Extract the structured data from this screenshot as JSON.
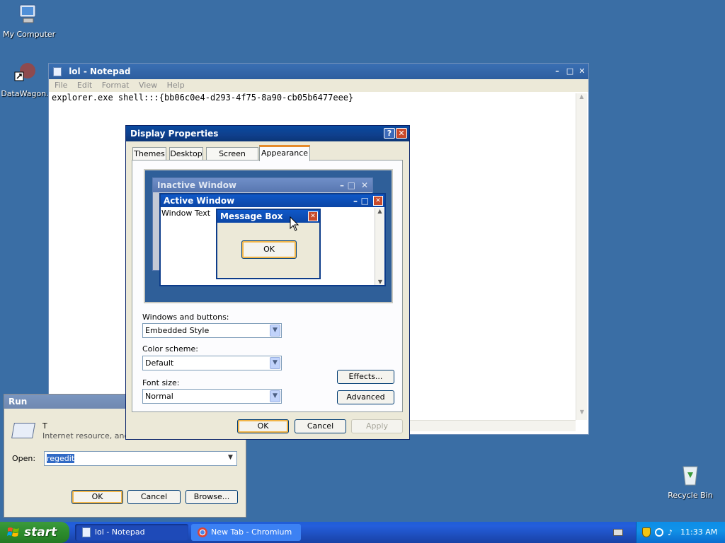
{
  "desktop": {
    "icons": [
      {
        "label": "My Computer"
      },
      {
        "label": "DataWagon."
      },
      {
        "label": "Recycle Bin"
      }
    ]
  },
  "notepad": {
    "title": "lol - Notepad",
    "menu": [
      "File",
      "Edit",
      "Format",
      "View",
      "Help"
    ],
    "content": "explorer.exe shell:::{bb06c0e4-d293-4f75-8a90-cb05b6477eee}"
  },
  "display_properties": {
    "title": "Display Properties",
    "help_btn": "?",
    "tabs": [
      "Themes",
      "Desktop",
      "Screen Saver",
      "Appearance"
    ],
    "active_tab": "Appearance",
    "preview": {
      "inactive_title": "Inactive Window",
      "active_title": "Active Window",
      "window_text": "Window Text",
      "msgbox_title": "Message Box",
      "msgbox_ok": "OK"
    },
    "windows_buttons_label": "Windows and buttons:",
    "windows_buttons_value": "Embedded Style",
    "color_scheme_label": "Color scheme:",
    "color_scheme_value": "Default",
    "font_size_label": "Font size:",
    "font_size_value": "Normal",
    "effects_btn": "Effects...",
    "advanced_btn": "Advanced",
    "ok_btn": "OK",
    "cancel_btn": "Cancel",
    "apply_btn": "Apply"
  },
  "run_dialog": {
    "title": "Run",
    "desc_line1": "T",
    "desc_line2": "Internet resource, and",
    "open_label": "Open:",
    "open_value": "regedit",
    "ok_btn": "OK",
    "cancel_btn": "Cancel",
    "browse_btn": "Browse..."
  },
  "taskbar": {
    "start_label": "start",
    "tasks": [
      {
        "label": "lol - Notepad"
      },
      {
        "label": "New Tab - Chromium"
      }
    ],
    "clock": "11:33 AM"
  },
  "colors": {
    "desktop": "#3a6ea5",
    "title_active": "#0a4aa0",
    "taskbar": "#245edb",
    "start": "#2c8c2c"
  }
}
